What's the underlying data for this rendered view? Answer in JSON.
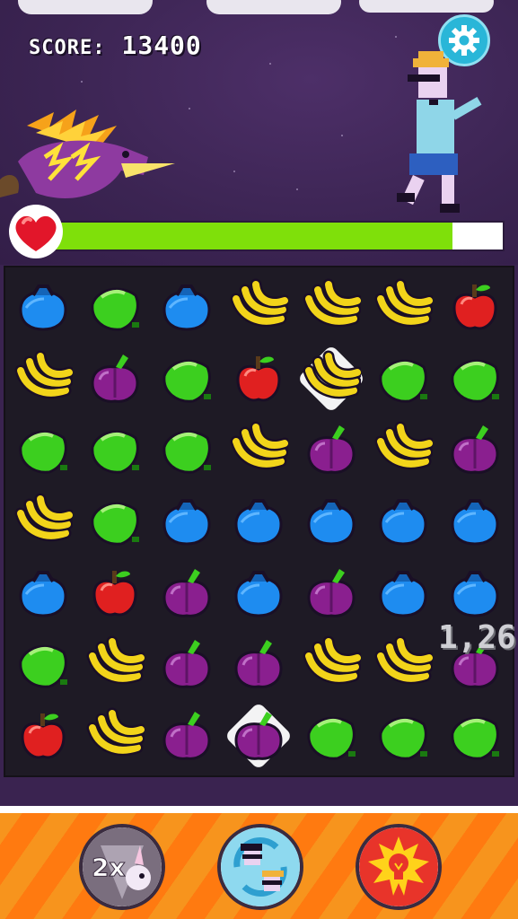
{
  "hud": {
    "score_label": "SCORE:",
    "score_value": "13400",
    "health_fraction": 0.89
  },
  "board": {
    "rows": [
      [
        "blueberry",
        "lime",
        "blueberry",
        "banana",
        "banana",
        "banana",
        "apple"
      ],
      [
        "banana",
        "plum",
        "lime",
        "apple",
        "banana",
        "lime",
        "lime"
      ],
      [
        "lime",
        "lime",
        "lime",
        "banana",
        "plum",
        "banana",
        "plum"
      ],
      [
        "banana",
        "lime",
        "blueberry",
        "blueberry",
        "blueberry",
        "blueberry",
        "blueberry"
      ],
      [
        "blueberry",
        "apple",
        "plum",
        "blueberry",
        "plum",
        "blueberry",
        "blueberry"
      ],
      [
        "lime",
        "banana",
        "plum",
        "plum",
        "banana",
        "banana",
        "plum"
      ],
      [
        "apple",
        "banana",
        "plum",
        "plum",
        "lime",
        "lime",
        "lime"
      ]
    ],
    "selected": [
      [
        1,
        4
      ],
      [
        6,
        3
      ]
    ],
    "floating_points": "1,26"
  },
  "colors": {
    "blueberry": "#1e8cf0",
    "lime": "#3ccf1f",
    "banana": "#f2d41a",
    "apple": "#e02020",
    "plum": "#8a1f8f",
    "health": "#7fe00a",
    "toolbar": "#f7941d"
  },
  "powerups": [
    {
      "name": "double-multiplier-powerup",
      "label": "2x",
      "icon": "unicorn-icon"
    },
    {
      "name": "swap-characters-powerup",
      "label": "",
      "icon": "swap-icon"
    },
    {
      "name": "hint-powerup",
      "label": "",
      "icon": "lightbulb-icon"
    }
  ],
  "icons": [
    "gear-icon",
    "heart-icon",
    "dragon-icon",
    "dancer-icon"
  ]
}
